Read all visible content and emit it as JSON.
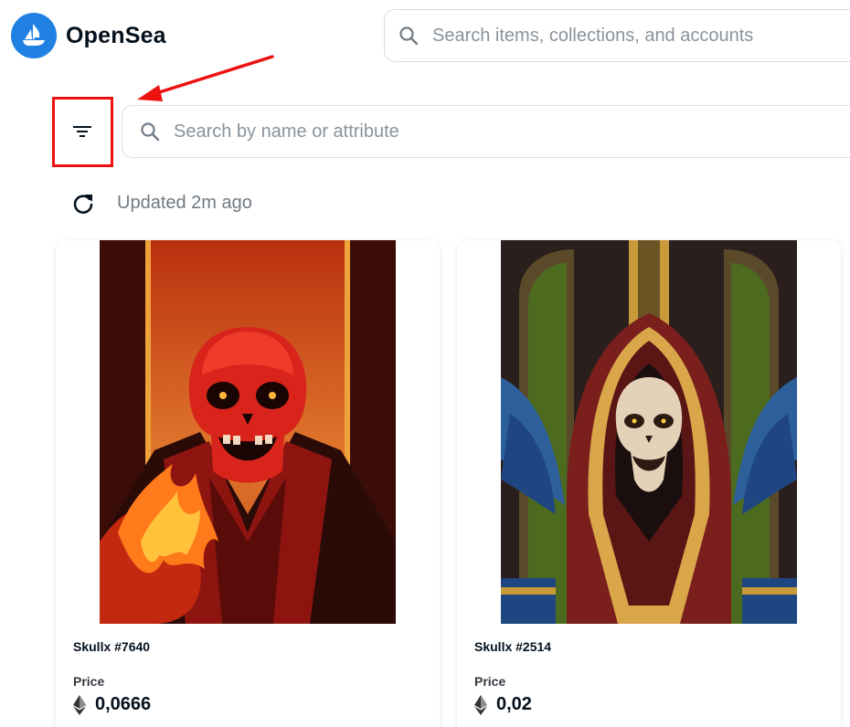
{
  "header": {
    "brand_name": "OpenSea",
    "search_placeholder": "Search items, collections, and accounts"
  },
  "collection": {
    "search_placeholder": "Search by name or attribute",
    "updated_text": "Updated 2m ago"
  },
  "items": [
    {
      "name": "Skullx #7640",
      "price_label": "Price",
      "price": "0,0666"
    },
    {
      "name": "Skullx #2514",
      "price_label": "Price",
      "price": "0,02"
    }
  ],
  "icons": {
    "logo": "opensea-logo-icon",
    "search": "search-icon",
    "filter": "filter-icon",
    "refresh": "refresh-icon",
    "currency": "ethereum-icon"
  },
  "colors": {
    "brand_blue": "#2081e2",
    "annotation_red": "#ee1111",
    "text_dark": "#04111d",
    "text_muted": "#707a83"
  }
}
